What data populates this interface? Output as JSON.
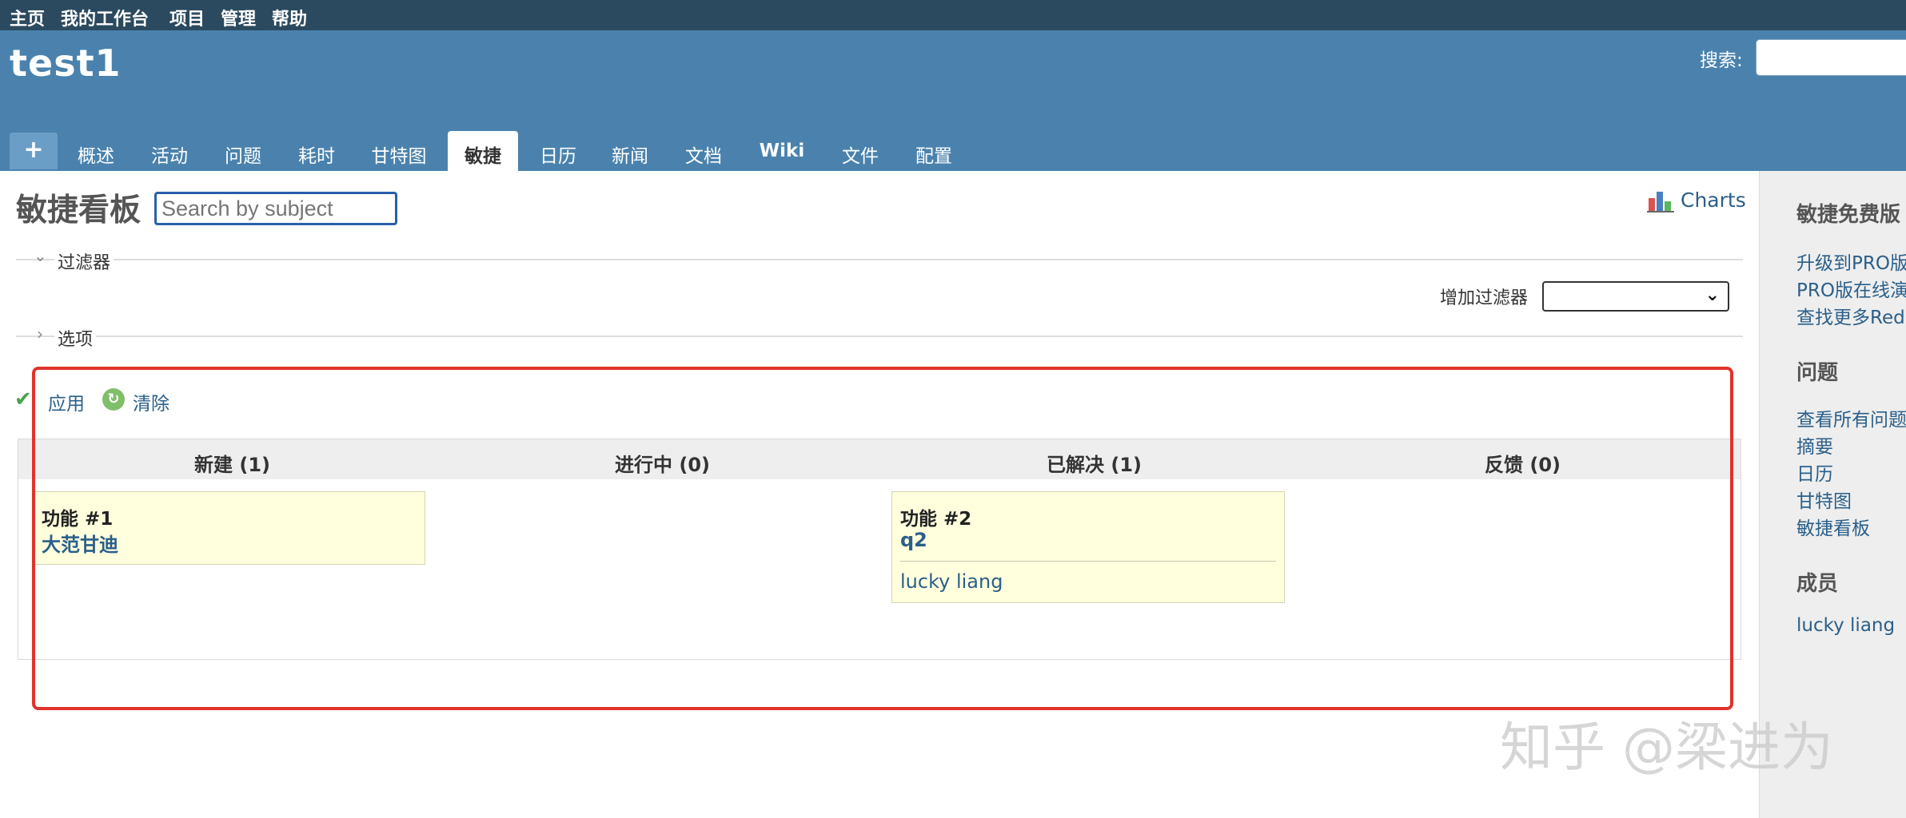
{
  "top_menu": [
    "主页",
    "我的工作台",
    "项目",
    "管理",
    "帮助"
  ],
  "header": {
    "project_title": "test1",
    "search_label": "搜索:"
  },
  "tabs": {
    "new": "+",
    "items": [
      "概述",
      "活动",
      "问题",
      "耗时",
      "甘特图",
      "敏捷",
      "日历",
      "新闻",
      "文档",
      "Wiki",
      "文件",
      "配置"
    ],
    "selected": "敏捷"
  },
  "main": {
    "title": "敏捷看板",
    "search_placeholder": "Search by subject",
    "charts_label": "Charts",
    "filters_legend": "过滤器",
    "add_filter_label": "增加过滤器",
    "options_legend": "选项",
    "apply_label": "应用",
    "clear_label": "清除"
  },
  "board": {
    "columns": [
      "新建 (1)",
      "进行中 (0)",
      "已解决 (1)",
      "反馈 (0)"
    ],
    "cards": [
      {
        "id": "功能 #1",
        "subject": "大范甘迪",
        "assignee": ""
      },
      {
        "id": "功能 #2",
        "subject": "q2",
        "assignee": "lucky liang"
      }
    ]
  },
  "sidebar": {
    "section1": {
      "title": "敏捷免费版",
      "links": [
        "升级到PRO版",
        "PRO版在线演",
        "查找更多Red"
      ]
    },
    "section2": {
      "title": "问题",
      "links": [
        "查看所有问题",
        "摘要",
        "日历",
        "甘特图",
        "敏捷看板"
      ]
    },
    "section3": {
      "title": "成员",
      "links": [
        "lucky liang"
      ]
    }
  },
  "watermark": "知乎 @梁进为",
  "colors": {
    "top_menu_bg": "#2c4a5f",
    "header_bg": "#4a82ad",
    "link": "#2a5f8a",
    "card_bg": "#ffffdd",
    "highlight": "#e0332a"
  }
}
